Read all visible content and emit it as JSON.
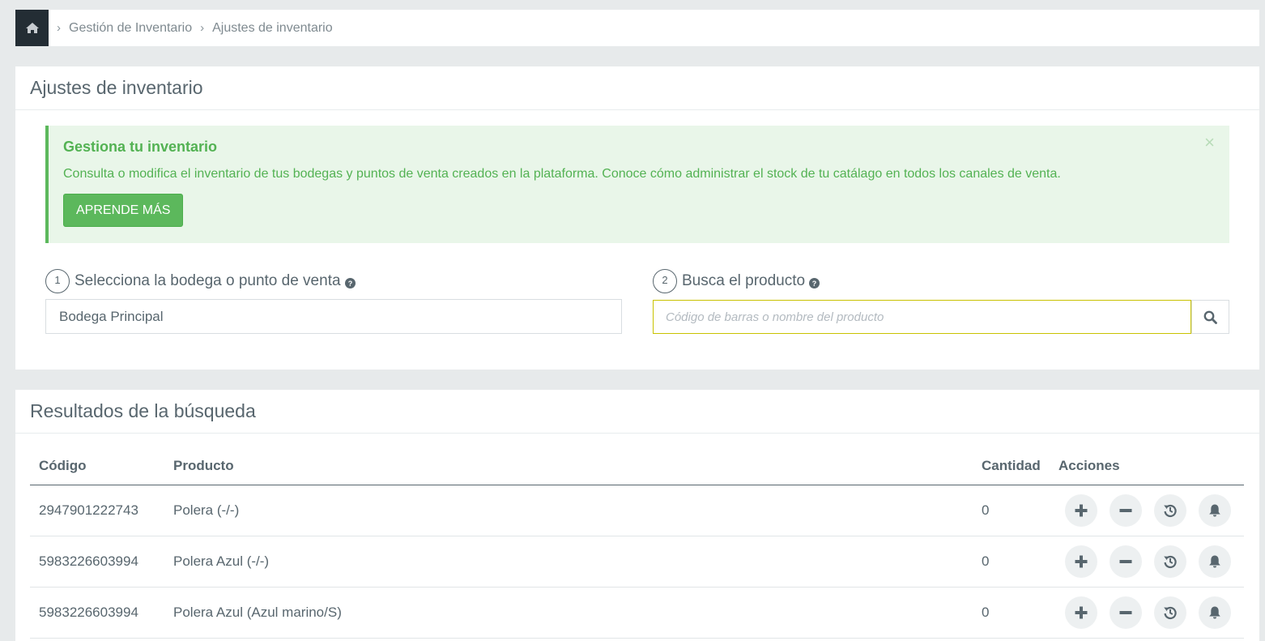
{
  "breadcrumb": {
    "home_icon": "home-icon",
    "items": [
      "Gestión de Inventario",
      "Ajustes de inventario"
    ]
  },
  "adjust_panel": {
    "title": "Ajustes de inventario",
    "alert": {
      "title": "Gestiona tu inventario",
      "text": "Consulta o modifica el inventario de tus bodegas y puntos de venta creados en la plataforma. Conoce cómo administrar el stock de tu catálago en todos los canales de venta.",
      "button": "APRENDE MÁS",
      "close": "×"
    },
    "step1": {
      "num": "1",
      "label": "Selecciona la bodega o punto de venta",
      "value": "Bodega Principal"
    },
    "step2": {
      "num": "2",
      "label": "Busca el producto",
      "placeholder": "Código de barras o nombre del producto"
    }
  },
  "results_panel": {
    "title": "Resultados de la búsqueda",
    "columns": {
      "code": "Código",
      "product": "Producto",
      "qty": "Cantidad",
      "actions": "Acciones"
    },
    "rows": [
      {
        "code": "2947901222743",
        "product": "Polera (-/-)",
        "qty": "0"
      },
      {
        "code": "5983226603994",
        "product": "Polera Azul (-/-)",
        "qty": "0"
      },
      {
        "code": "5983226603994",
        "product": "Polera Azul (Azul marino/S)",
        "qty": "0"
      }
    ],
    "action_icons": [
      "plus-icon",
      "minus-icon",
      "history-icon",
      "bell-icon"
    ]
  },
  "colors": {
    "dark": "#232d34",
    "text": "#58666e",
    "success": "#5cb85c",
    "alert_bg": "#e9f6e9",
    "focus_border": "#c9c200"
  }
}
